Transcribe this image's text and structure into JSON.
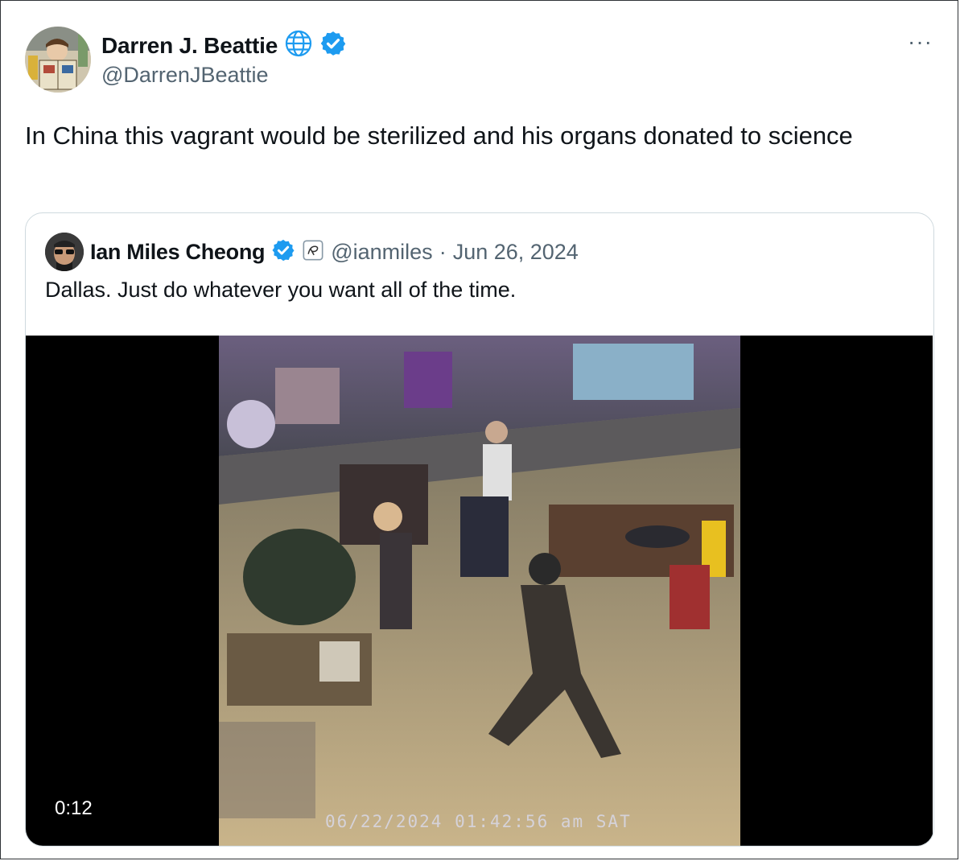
{
  "tweet": {
    "author_name": "Darren J. Beattie",
    "author_handle": "@DarrenJBeattie",
    "text": "In China this vagrant would be sterilized and his organs donated to science",
    "more_label": "···"
  },
  "quoted": {
    "author_name": "Ian Miles Cheong",
    "author_handle": "@ianmiles",
    "separator": "·",
    "date": "Jun 26, 2024",
    "text": "Dallas. Just do whatever you want all of the time.",
    "video": {
      "duration": "0:12",
      "timestamp_overlay": "06/22/2024 01:42:56 am SAT"
    }
  },
  "colors": {
    "verified": "#1d9bf0",
    "secondary_text": "#536471",
    "border": "#cfd9de"
  },
  "icons": [
    "globe-icon",
    "verified-badge-icon",
    "more-icon",
    "affiliate-badge-icon"
  ]
}
